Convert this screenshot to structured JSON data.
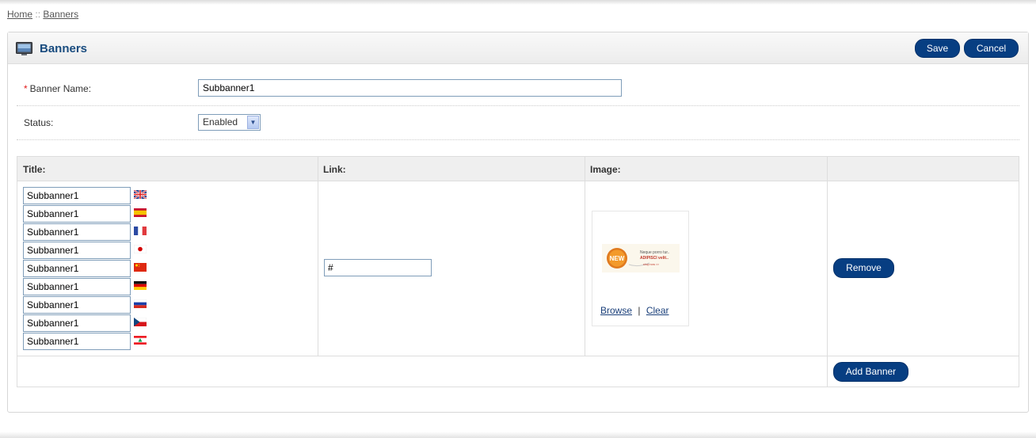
{
  "breadcrumb": {
    "home": "Home",
    "separator": "::",
    "current": "Banners"
  },
  "header": {
    "title": "Banners",
    "icon": "banner-monitor-icon",
    "save_label": "Save",
    "cancel_label": "Cancel"
  },
  "form": {
    "banner_name": {
      "required_mark": "*",
      "label": "Banner Name:",
      "value": "Subbanner1"
    },
    "status": {
      "label": "Status:",
      "selected": "Enabled"
    }
  },
  "table": {
    "columns": {
      "title": "Title:",
      "link": "Link:",
      "image": "Image:"
    },
    "row": {
      "titles": [
        {
          "value": "Subbanner1",
          "flag": "united-kingdom-flag-icon"
        },
        {
          "value": "Subbanner1",
          "flag": "spain-flag-icon"
        },
        {
          "value": "Subbanner1",
          "flag": "france-flag-icon"
        },
        {
          "value": "Subbanner1",
          "flag": "japan-flag-icon"
        },
        {
          "value": "Subbanner1",
          "flag": "china-flag-icon"
        },
        {
          "value": "Subbanner1",
          "flag": "germany-flag-icon"
        },
        {
          "value": "Subbanner1",
          "flag": "russia-flag-icon"
        },
        {
          "value": "Subbanner1",
          "flag": "czech-flag-icon"
        },
        {
          "value": "Subbanner1",
          "flag": "lebanon-flag-icon"
        }
      ],
      "link": "#",
      "image": {
        "browse_label": "Browse",
        "divider": "|",
        "clear_label": "Clear"
      },
      "remove_label": "Remove"
    },
    "add_label": "Add Banner"
  },
  "colors": {
    "button_blue": "#073e82",
    "title_blue": "#194c7f",
    "required_red": "#e31b1b"
  }
}
